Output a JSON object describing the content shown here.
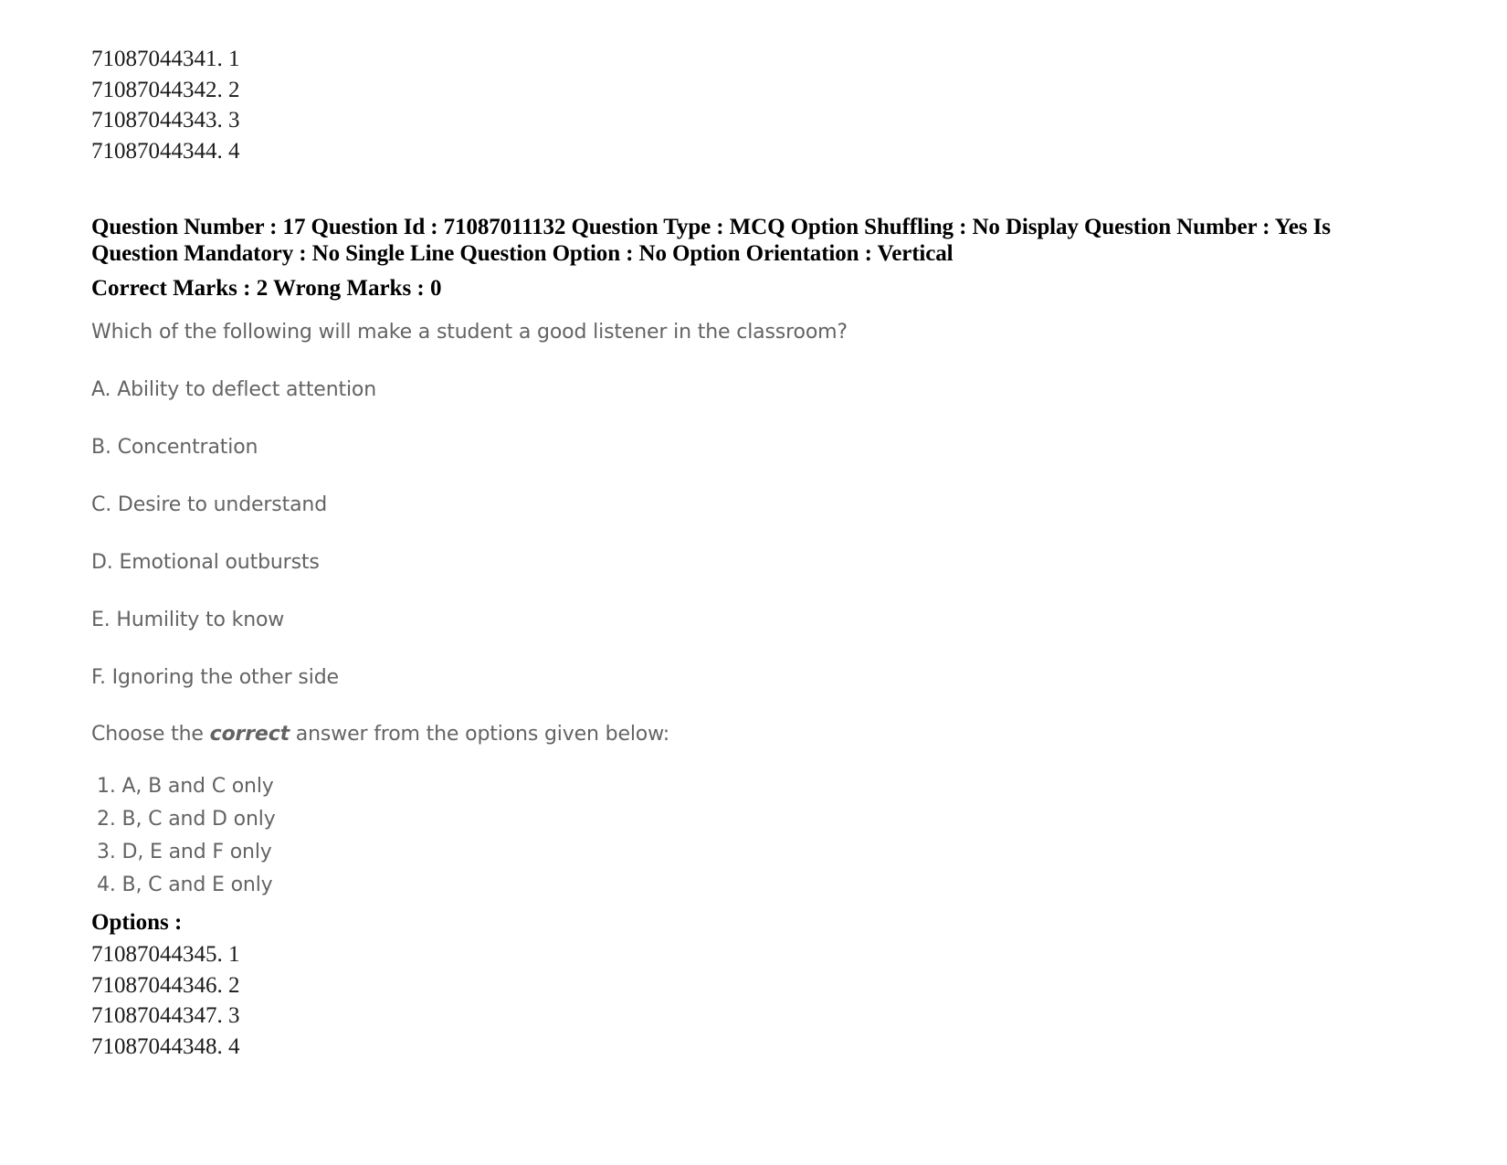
{
  "top_option_ids": [
    "71087044341. 1",
    "71087044342. 2",
    "71087044343. 3",
    "71087044344. 4"
  ],
  "meta": {
    "line1": "Question Number : 17 Question Id : 71087011132 Question Type : MCQ Option Shuffling : No Display Question Number : Yes Is Question Mandatory : No Single Line Question Option : No Option Orientation : Vertical",
    "marks_line": "Correct Marks : 2 Wrong Marks : 0"
  },
  "question": {
    "stem": "Which of the following will make a student a good listener in the classroom?",
    "statements": [
      "A. Ability to deflect attention",
      "B. Concentration",
      "C. Desire to understand",
      "D. Emotional outbursts",
      "E. Humility to know",
      "F. Ignoring the other side"
    ],
    "choose_prefix": "Choose the ",
    "choose_emphasis": "correct",
    "choose_suffix": " answer from the options given below:",
    "answers": [
      "1. A, B and C only",
      "2. B, C and D only",
      "3. D, E and F only",
      "4. B, C and E only"
    ]
  },
  "options_section": {
    "label": "Options :",
    "option_ids": [
      "71087044345. 1",
      "71087044346. 2",
      "71087044347. 3",
      "71087044348. 4"
    ]
  },
  "colors": {
    "page_background": "#ffffff",
    "serif_text": "#000000",
    "scanned_text": "#4a4a4a"
  }
}
